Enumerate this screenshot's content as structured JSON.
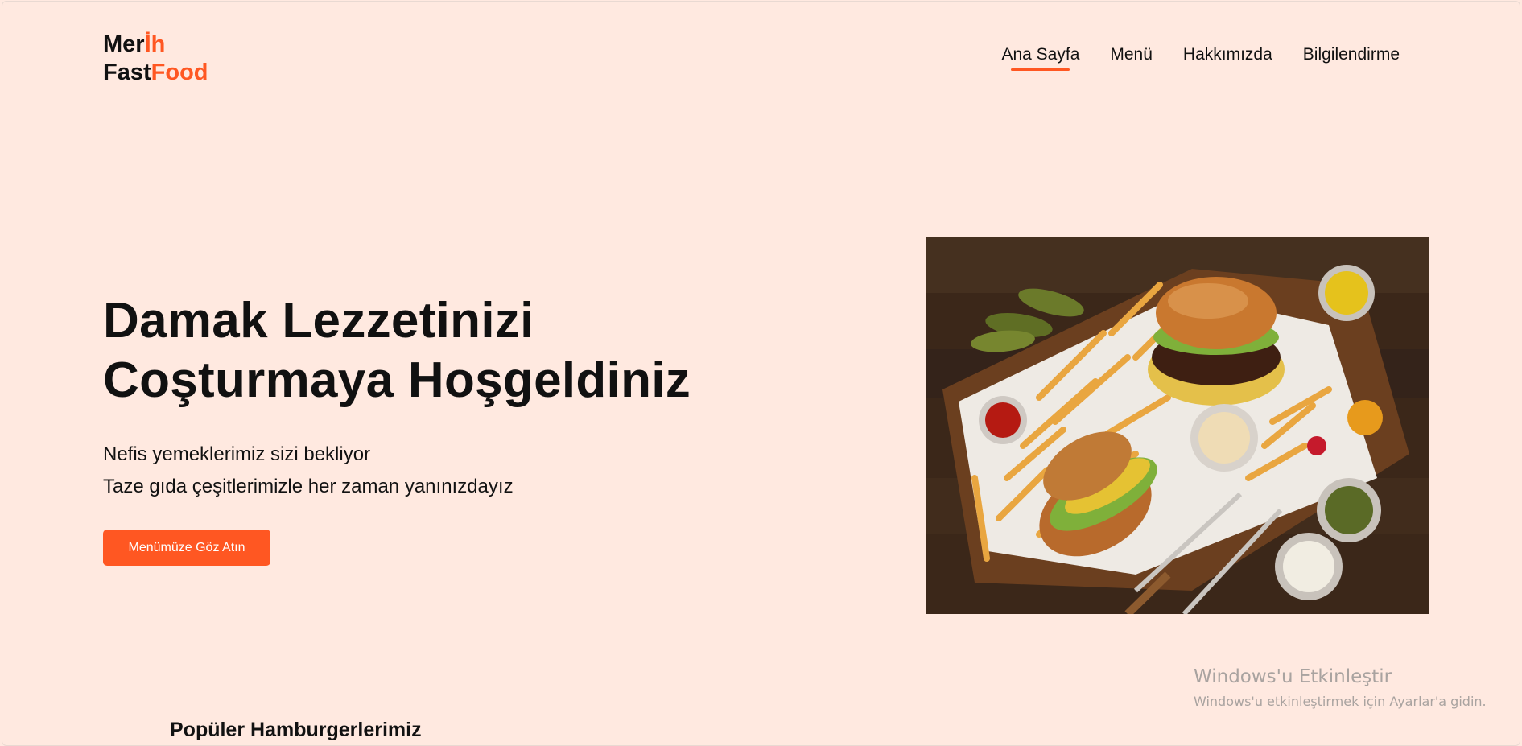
{
  "brand": {
    "line1_part1": "Mer",
    "line1_part2": "İh",
    "line2_part1": "Fast",
    "line2_part2": "Food"
  },
  "nav": {
    "items": [
      {
        "label": "Ana Sayfa",
        "active": true
      },
      {
        "label": "Menü"
      },
      {
        "label": "Hakkımızda"
      },
      {
        "label": "Bilgilendirme"
      }
    ]
  },
  "hero": {
    "title_line1": "Damak Lezzetinizi",
    "title_line2": "Coşturmaya Hoşgeldiniz",
    "subtitle_line1": "Nefis yemeklerimiz sizi bekliyor",
    "subtitle_line2": "Taze gıda çeşitlerimizle her zaman yanınızdayız",
    "cta_label": "Menümüze Göz Atın",
    "image_icon": "burger-fries-photo"
  },
  "popular": {
    "title": "Popüler Hamburgerlerimiz"
  },
  "watermark": {
    "title": "Windows'u Etkinleştir",
    "subtitle": "Windows'u etkinleştirmek için Ayarlar'a gidin."
  },
  "colors": {
    "background": "#ffe9e0",
    "accent": "#ff5722",
    "text": "#111111"
  }
}
